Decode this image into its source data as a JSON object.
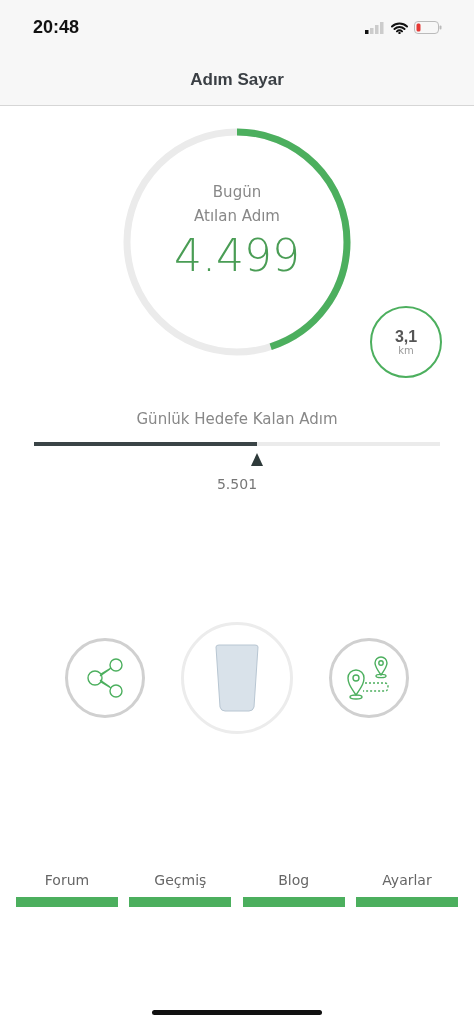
{
  "status_bar": {
    "time": "20:48"
  },
  "header": {
    "title": "Adım Sayar"
  },
  "today": {
    "label_line1": "Bugün",
    "label_line2": "Atılan Adım",
    "steps": "4.499"
  },
  "distance": {
    "value": "3,1",
    "unit": "km"
  },
  "goal": {
    "label": "Günlük Hedefe Kalan Adım",
    "level": 0.55,
    "remaining": "5.501"
  },
  "tabs": [
    {
      "label": "Forum"
    },
    {
      "label": "Geçmiş"
    },
    {
      "label": "Blog"
    },
    {
      "label": "Ayarlar"
    }
  ]
}
